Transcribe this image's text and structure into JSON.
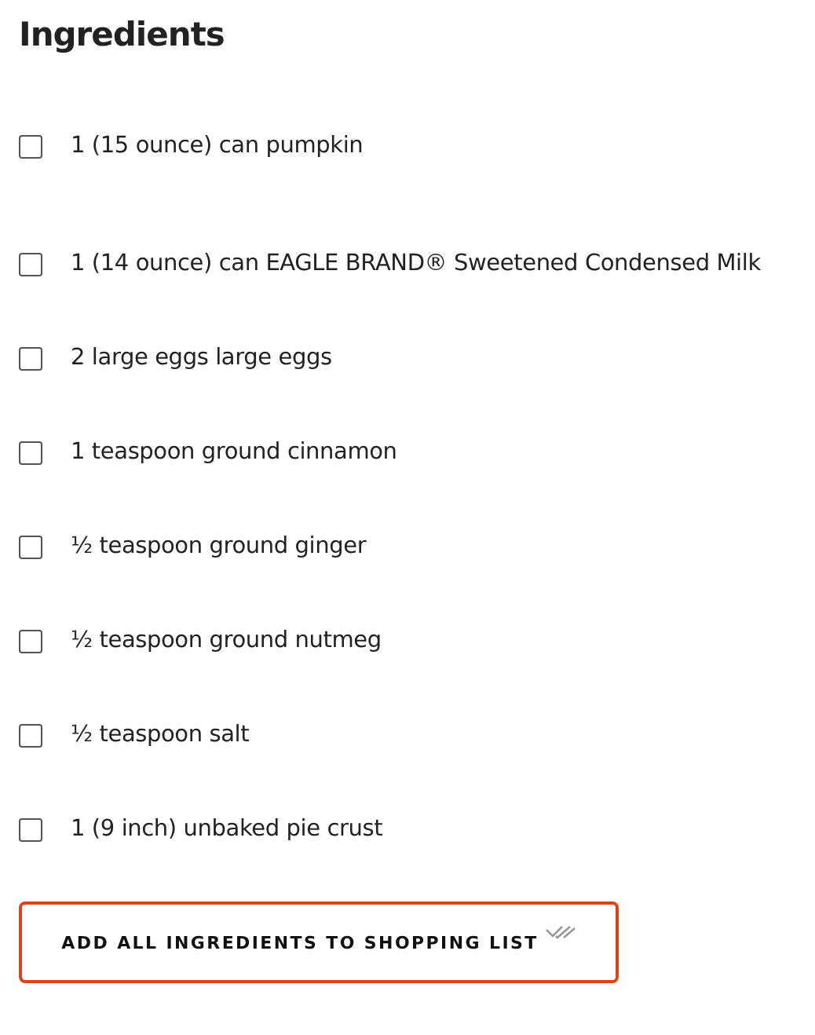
{
  "title": "Ingredients",
  "ingredients": [
    {
      "label": "1 (15 ounce) can pumpkin",
      "checked": false
    },
    {
      "label": "1 (14 ounce) can EAGLE BRAND® Sweetened Condensed Milk",
      "checked": false
    },
    {
      "label": "2 large eggs large eggs",
      "checked": false
    },
    {
      "label": "1 teaspoon ground cinnamon",
      "checked": false
    },
    {
      "label": "½ teaspoon ground ginger",
      "checked": false
    },
    {
      "label": "½ teaspoon ground nutmeg",
      "checked": false
    },
    {
      "label": "½ teaspoon salt",
      "checked": false
    },
    {
      "label": "1 (9 inch) unbaked pie crust",
      "checked": false
    }
  ],
  "button": {
    "label": "ADD ALL INGREDIENTS TO SHOPPING LIST"
  }
}
